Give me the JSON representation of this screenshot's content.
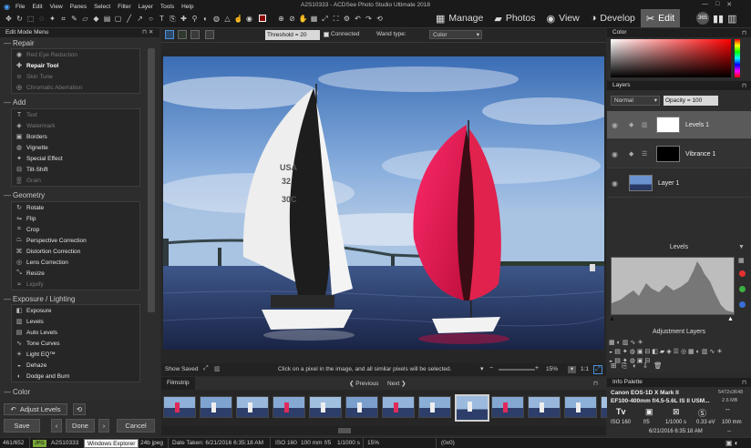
{
  "app": {
    "title": "A2S10333 - ACDSee Photo Studio Ultimate 2018",
    "menu": [
      "File",
      "Edit",
      "View",
      "Panes",
      "Select",
      "Filter",
      "Layer",
      "Tools",
      "Help"
    ],
    "modes": [
      {
        "label": "Manage",
        "icon": "grid-icon"
      },
      {
        "label": "Photos",
        "icon": "photos-icon"
      },
      {
        "label": "View",
        "icon": "eye-icon"
      },
      {
        "label": "Develop",
        "icon": "develop-icon"
      },
      {
        "label": "Edit",
        "icon": "edit-icon",
        "active": true
      }
    ],
    "badge": "365",
    "window_controls": [
      "—",
      "□",
      "✕"
    ]
  },
  "left": {
    "title": "Edit Mode Menu",
    "groups": [
      {
        "name": "Repair",
        "items": [
          {
            "label": "Red Eye Reduction",
            "state": "dim",
            "icon": "eye-icon"
          },
          {
            "label": "Repair Tool",
            "state": "bold",
            "icon": "bandage-icon"
          },
          {
            "label": "Skin Tune",
            "state": "dim",
            "icon": "skin-icon"
          },
          {
            "label": "Chromatic Aberration",
            "state": "dim",
            "icon": "aberration-icon"
          }
        ]
      },
      {
        "name": "Add",
        "items": [
          {
            "label": "Text",
            "state": "dim",
            "icon": "text-icon"
          },
          {
            "label": "Watermark",
            "state": "dim",
            "icon": "watermark-icon"
          },
          {
            "label": "Borders",
            "state": "normal",
            "icon": "borders-icon"
          },
          {
            "label": "Vignette",
            "state": "normal",
            "icon": "vignette-icon"
          },
          {
            "label": "Special Effect",
            "state": "normal",
            "icon": "effect-icon"
          },
          {
            "label": "Tilt-Shift",
            "state": "normal",
            "icon": "tiltshift-icon"
          },
          {
            "label": "Grain",
            "state": "dim",
            "icon": "grain-icon"
          }
        ]
      },
      {
        "name": "Geometry",
        "items": [
          {
            "label": "Rotate",
            "state": "normal",
            "icon": "rotate-icon"
          },
          {
            "label": "Flip",
            "state": "normal",
            "icon": "flip-icon"
          },
          {
            "label": "Crop",
            "state": "normal",
            "icon": "crop-icon"
          },
          {
            "label": "Perspective Correction",
            "state": "normal",
            "icon": "perspective-icon"
          },
          {
            "label": "Distortion Correction",
            "state": "normal",
            "icon": "distortion-icon"
          },
          {
            "label": "Lens Correction",
            "state": "normal",
            "icon": "lens-icon"
          },
          {
            "label": "Resize",
            "state": "normal",
            "icon": "resize-icon"
          },
          {
            "label": "Liquify",
            "state": "dim",
            "icon": "liquify-icon"
          }
        ]
      },
      {
        "name": "Exposure / Lighting",
        "items": [
          {
            "label": "Exposure",
            "state": "normal",
            "icon": "exposure-icon"
          },
          {
            "label": "Levels",
            "state": "normal",
            "icon": "levels-icon"
          },
          {
            "label": "Auto Levels",
            "state": "normal",
            "icon": "auto-levels-icon"
          },
          {
            "label": "Tone Curves",
            "state": "normal",
            "icon": "curves-icon"
          },
          {
            "label": "Light EQ™",
            "state": "normal",
            "icon": "light-eq-icon"
          },
          {
            "label": "Dehaze",
            "state": "normal",
            "icon": "dehaze-icon"
          },
          {
            "label": "Dodge and Burn",
            "state": "normal",
            "icon": "dodge-burn-icon"
          }
        ]
      },
      {
        "name": "Color",
        "items": []
      }
    ],
    "adjust_levels": "Adjust Levels",
    "save": "Save",
    "done": "Done",
    "cancel": "Cancel"
  },
  "toolopts": {
    "threshold": "Threshold = 20",
    "connected": "Connected",
    "wand_type_label": "Wand type:",
    "wand_type_value": "Color"
  },
  "viewer": {
    "show_saved": "Show Saved",
    "hint": "Click on a pixel in the image, and all similar pixels will be selected.",
    "zoom": "15%",
    "ratio": "1:1"
  },
  "filmstrip": {
    "title": "Filmstrip",
    "previous": "Previous",
    "next": "Next",
    "thumbs": 13,
    "selected_index": 8
  },
  "right": {
    "color_title": "Color",
    "layers_title": "Layers",
    "blend_mode": "Normal",
    "opacity": "Opacity = 100",
    "layers": [
      {
        "name": "Levels 1",
        "selected": true,
        "kind": "adjust-white"
      },
      {
        "name": "Vibrance 1",
        "selected": false,
        "kind": "adjust-black"
      },
      {
        "name": "Layer 1",
        "selected": false,
        "kind": "photo"
      }
    ],
    "levels_title": "Levels",
    "adjustment_layers_title": "Adjustment Layers",
    "info_title": "Info Palette",
    "info": {
      "camera": "Canon EOS-1D X Mark II",
      "dims": "5472x3648",
      "lens": "EF100-400mm f/4.5-5.6L IS II USM...",
      "size": "2.6 MB",
      "mode": "Tv",
      "iso": "ISO 160",
      "aperture": "f/5",
      "shutter": "1/1000 s",
      "ev": "0.33 eV",
      "focal": "100 mm",
      "date": "6/21/2016 6:35:18 AM",
      "flash": "--",
      "wb": "--"
    }
  },
  "status": {
    "count": "461/652",
    "format": "JPG",
    "filename": "A2S10333",
    "tooltip": "Windows Explorer",
    "file_info": "24b jpeg",
    "date": "Date Taken: 6/21/2016 6:35:18 AM",
    "iso": "ISO 160",
    "focal": "100 mm",
    "aperture": "f/5",
    "shutter": "1/1000 s",
    "zoom": "15%",
    "coords": "(0x0)"
  }
}
